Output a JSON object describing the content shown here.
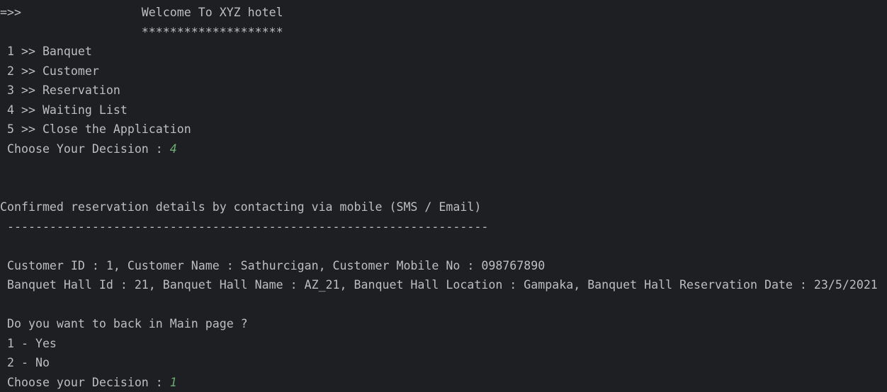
{
  "colors": {
    "background": "#1e1f22",
    "text": "#bcbec4",
    "user_input": "#6aab73"
  },
  "console": {
    "lines": [
      {
        "text": "=>>                 Welcome To XYZ hotel"
      },
      {
        "text": "                    ********************"
      },
      {
        "text": " 1 >> Banquet"
      },
      {
        "text": " 2 >> Customer"
      },
      {
        "text": " 3 >> Reservation"
      },
      {
        "text": " 4 >> Waiting List"
      },
      {
        "text": " 5 >> Close the Application"
      },
      {
        "text": " Choose Your Decision : ",
        "input": "4"
      },
      {
        "text": ""
      },
      {
        "text": ""
      },
      {
        "text": "Confirmed reservation details by contacting via mobile (SMS / Email)"
      },
      {
        "text": " --------------------------------------------------------------------"
      },
      {
        "text": ""
      },
      {
        "text": " Customer ID : 1, Customer Name : Sathurcigan, Customer Mobile No : 098767890"
      },
      {
        "text": " Banquet Hall Id : 21, Banquet Hall Name : AZ_21, Banquet Hall Location : Gampaka, Banquet Hall Reservation Date : 23/5/2021"
      },
      {
        "text": ""
      },
      {
        "text": " Do you want to back in Main page ?"
      },
      {
        "text": " 1 - Yes"
      },
      {
        "text": " 2 - No"
      },
      {
        "text": " Choose your Decision : ",
        "input": "1"
      }
    ]
  }
}
